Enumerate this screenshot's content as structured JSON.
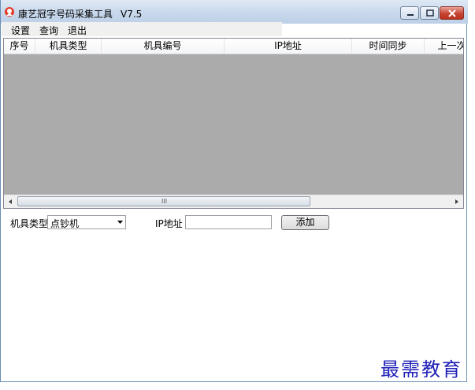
{
  "window": {
    "title": "康艺冠字号码采集工具",
    "version": "V7.5"
  },
  "menu": {
    "items": [
      {
        "label": "设置"
      },
      {
        "label": "查询"
      },
      {
        "label": "退出"
      }
    ]
  },
  "table": {
    "columns": [
      "序号",
      "机具类型",
      "机具编号",
      "IP地址",
      "时间同步",
      "上一次"
    ],
    "rows": []
  },
  "scrollbar": {
    "grip": "III"
  },
  "form": {
    "device_type_label": "机具类型",
    "device_type_value": "点钞机",
    "ip_label": "IP地址",
    "ip_value": "",
    "add_label": "添加"
  },
  "watermark": "最需教育",
  "colors": {
    "title_gradient_top": "#dfe9f5",
    "list_background": "#ababab",
    "close_button": "#c84432",
    "watermark": "#1f1fb8"
  }
}
